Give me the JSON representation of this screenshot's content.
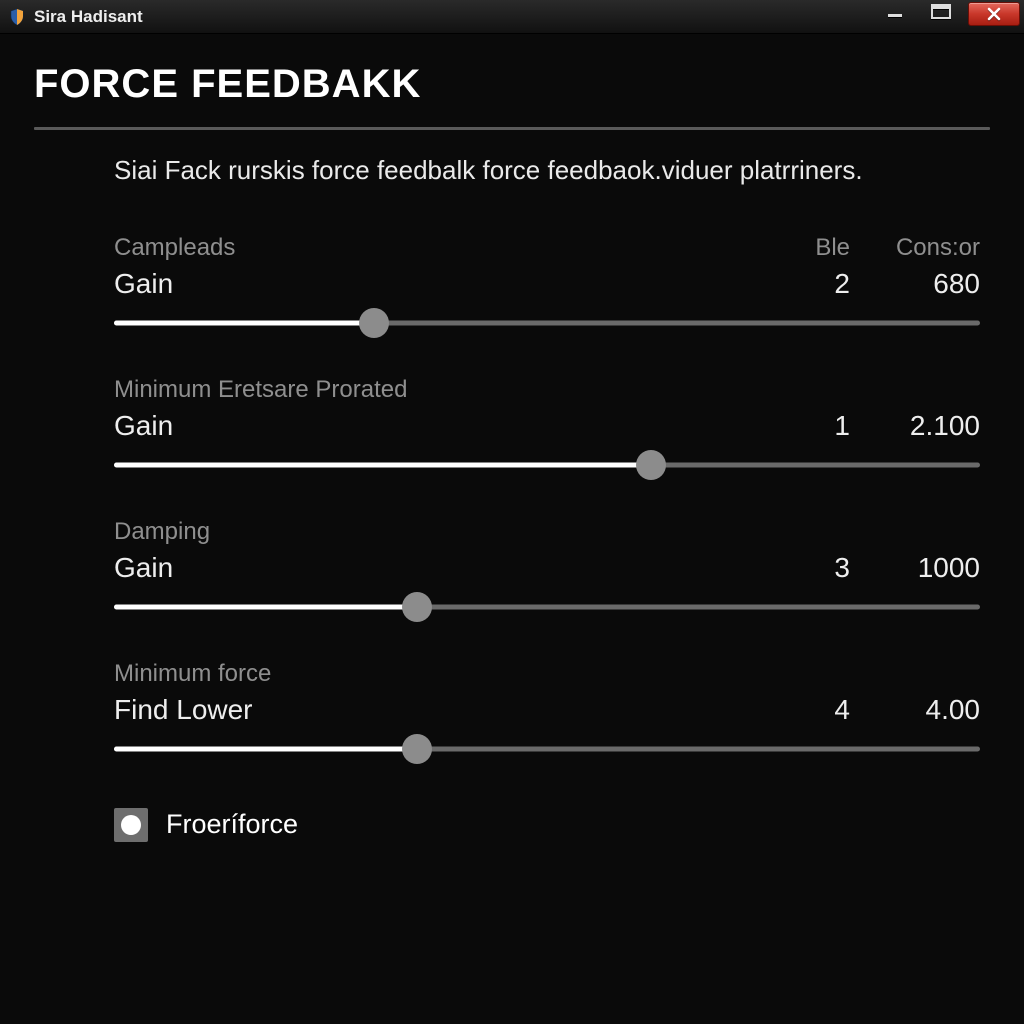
{
  "window": {
    "title": "Sira Hadisant"
  },
  "page": {
    "title": "FORCE FEEDBAKK",
    "description": "Siai Fack rurskis force feedbalk force feedbaok.viduer platrriners."
  },
  "columns": {
    "left": "Campleads",
    "ble": "Ble",
    "cons": "Cons:or"
  },
  "sliders": [
    {
      "group": "Campleads",
      "name": "Gain",
      "ble": "2",
      "cons": "680",
      "percent": 30,
      "show_group_label": false
    },
    {
      "group": "Minimum Eretsare Prorated",
      "name": "Gain",
      "ble": "1",
      "cons": "2.100",
      "percent": 62,
      "show_group_label": true
    },
    {
      "group": "Damping",
      "name": "Gain",
      "ble": "3",
      "cons": "1000",
      "percent": 35,
      "show_group_label": true
    },
    {
      "group": "Minimum force",
      "name": "Find Lower",
      "ble": "4",
      "cons": "4.00",
      "percent": 35,
      "show_group_label": true
    }
  ],
  "checkbox": {
    "label": "Froeríforce",
    "checked": true
  }
}
